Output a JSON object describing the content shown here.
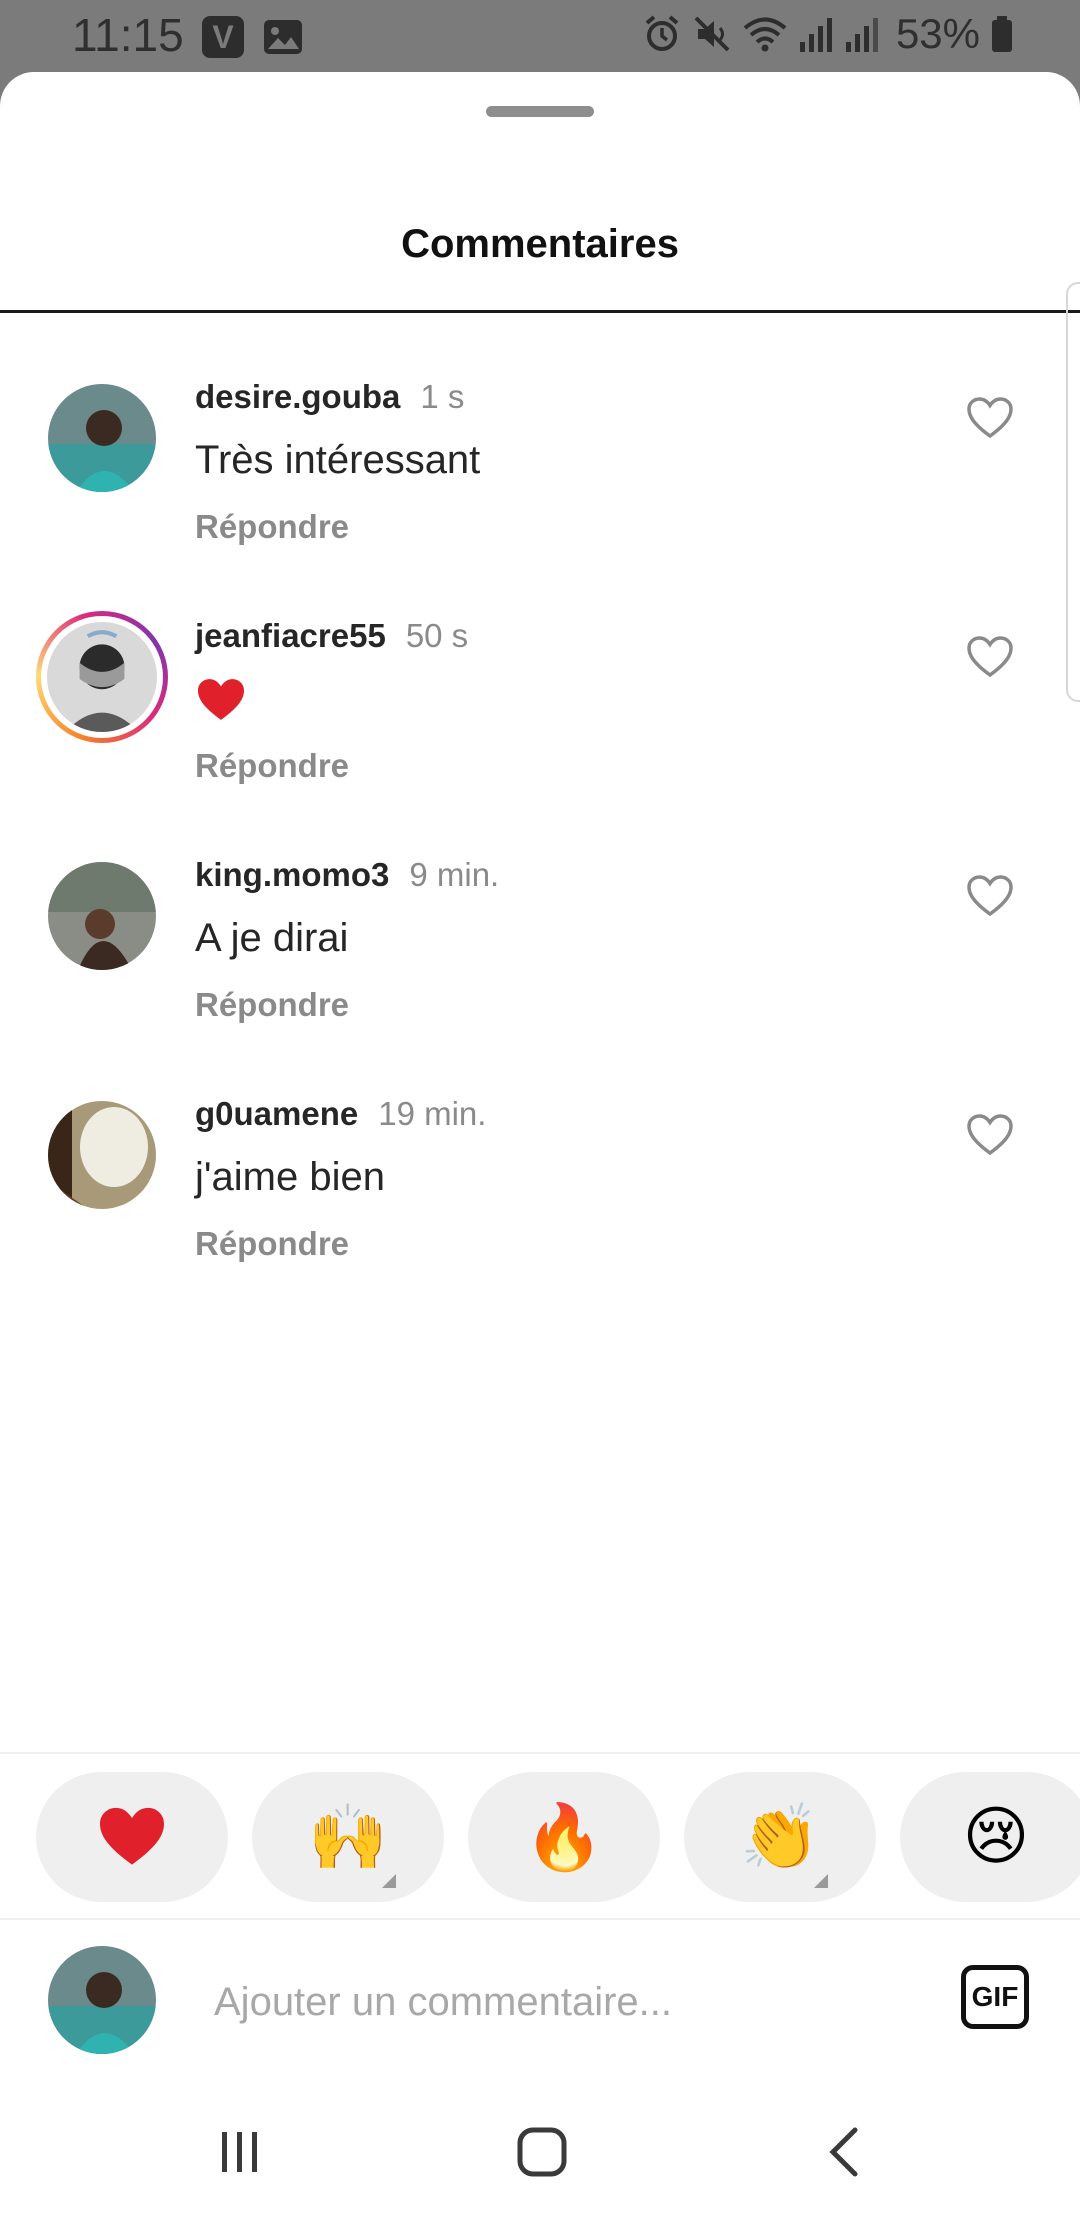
{
  "status_bar": {
    "time": "11:15",
    "battery": "53%",
    "left_icons": [
      "vpn-app-icon",
      "image-icon"
    ],
    "right_icons": [
      "alarm-icon",
      "mute-icon",
      "wifi-icon",
      "signal-icon",
      "signal-icon-2",
      "battery-icon"
    ]
  },
  "sheet": {
    "title": "Commentaires"
  },
  "comments": [
    {
      "username": "desire.gouba",
      "time": "1 s",
      "text": "Très intéressant",
      "reply": "Répondre",
      "has_story": false
    },
    {
      "username": "jeanfiacre55",
      "time": "50 s",
      "text": "❤️",
      "reply": "Répondre",
      "has_story": true
    },
    {
      "username": "king.momo3",
      "time": "9 min.",
      "text": "A je dirai",
      "reply": "Répondre",
      "has_story": false
    },
    {
      "username": "g0uamene",
      "time": "19 min.",
      "text": "j'aime bien",
      "reply": "Répondre",
      "has_story": false
    }
  ],
  "reactions": [
    {
      "emoji": "❤️",
      "has_variants": false
    },
    {
      "emoji": "🙌",
      "has_variants": true
    },
    {
      "emoji": "🔥",
      "has_variants": false
    },
    {
      "emoji": "👏",
      "has_variants": true
    },
    {
      "emoji": "😢",
      "has_variants": false
    }
  ],
  "composer": {
    "placeholder": "Ajouter un commentaire...",
    "gif_label": "GIF"
  },
  "colors": {
    "status_bar_bg": "#7b7b7b",
    "text_primary": "#262626",
    "text_secondary": "#8a8a8a",
    "reaction_bg": "#efefef"
  }
}
